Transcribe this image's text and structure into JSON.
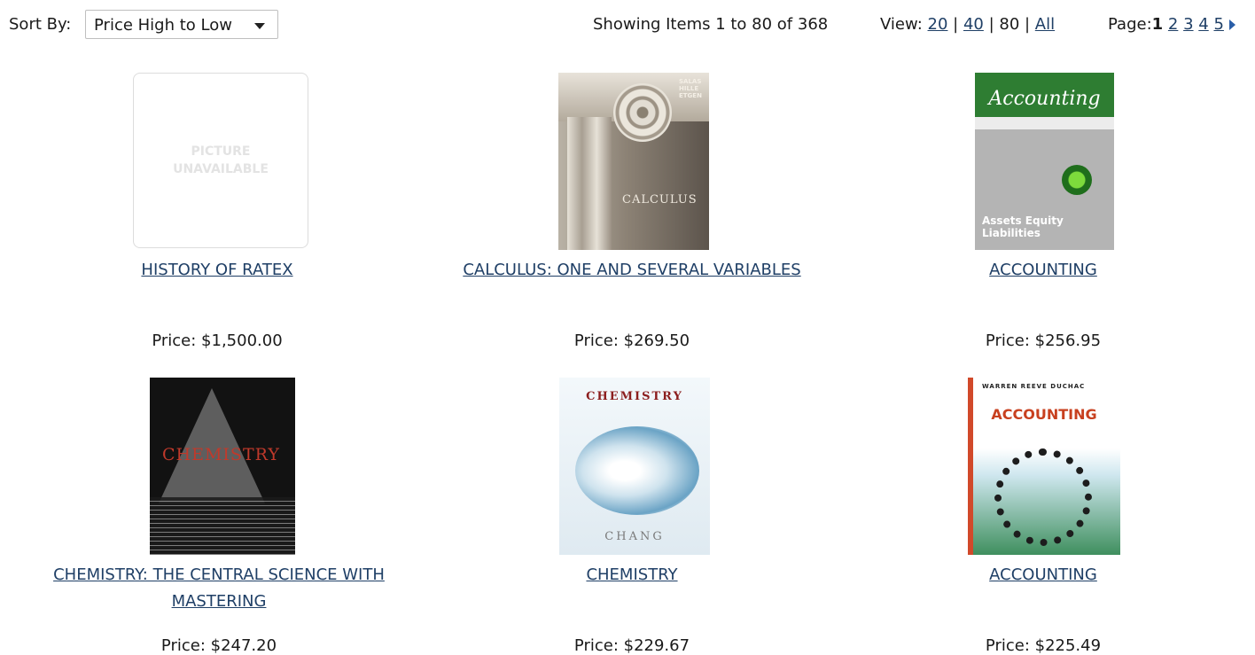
{
  "toolbar": {
    "sort_label": "Sort By:",
    "sort_value": "Price High to Low",
    "showing": "Showing Items 1 to 80 of 368",
    "view_label": "View:",
    "view_options": [
      "20",
      "40",
      "80",
      "All"
    ],
    "page_label": "Page:",
    "pages": [
      "1",
      "2",
      "3",
      "4",
      "5"
    ]
  },
  "products": [
    {
      "title": "HISTORY OF RATEX",
      "price": "Price: $1,500.00",
      "cover_text": "PICTURE UNAVAILABLE"
    },
    {
      "title": "CALCULUS: ONE AND SEVERAL VARIABLES",
      "price": "Price: $269.50",
      "cover_text": "CALCULUS",
      "cover_authors": "SALAS HILLE ETGEN"
    },
    {
      "title": "ACCOUNTING",
      "price": "Price: $256.95",
      "cover_text": "Accounting",
      "cover_words": "Assets Equity Liabilities"
    },
    {
      "title": "CHEMISTRY: THE CENTRAL SCIENCE WITH MASTERING",
      "price": "Price: $247.20",
      "cover_text": "CHEMISTRY"
    },
    {
      "title": "CHEMISTRY",
      "price": "Price: $229.67",
      "cover_text": "CHEMISTRY",
      "cover_author": "CHANG"
    },
    {
      "title": "ACCOUNTING",
      "price": "Price: $225.49",
      "cover_text": "ACCOUNTING",
      "cover_authors": "WARREN REEVE DUCHAC"
    }
  ]
}
